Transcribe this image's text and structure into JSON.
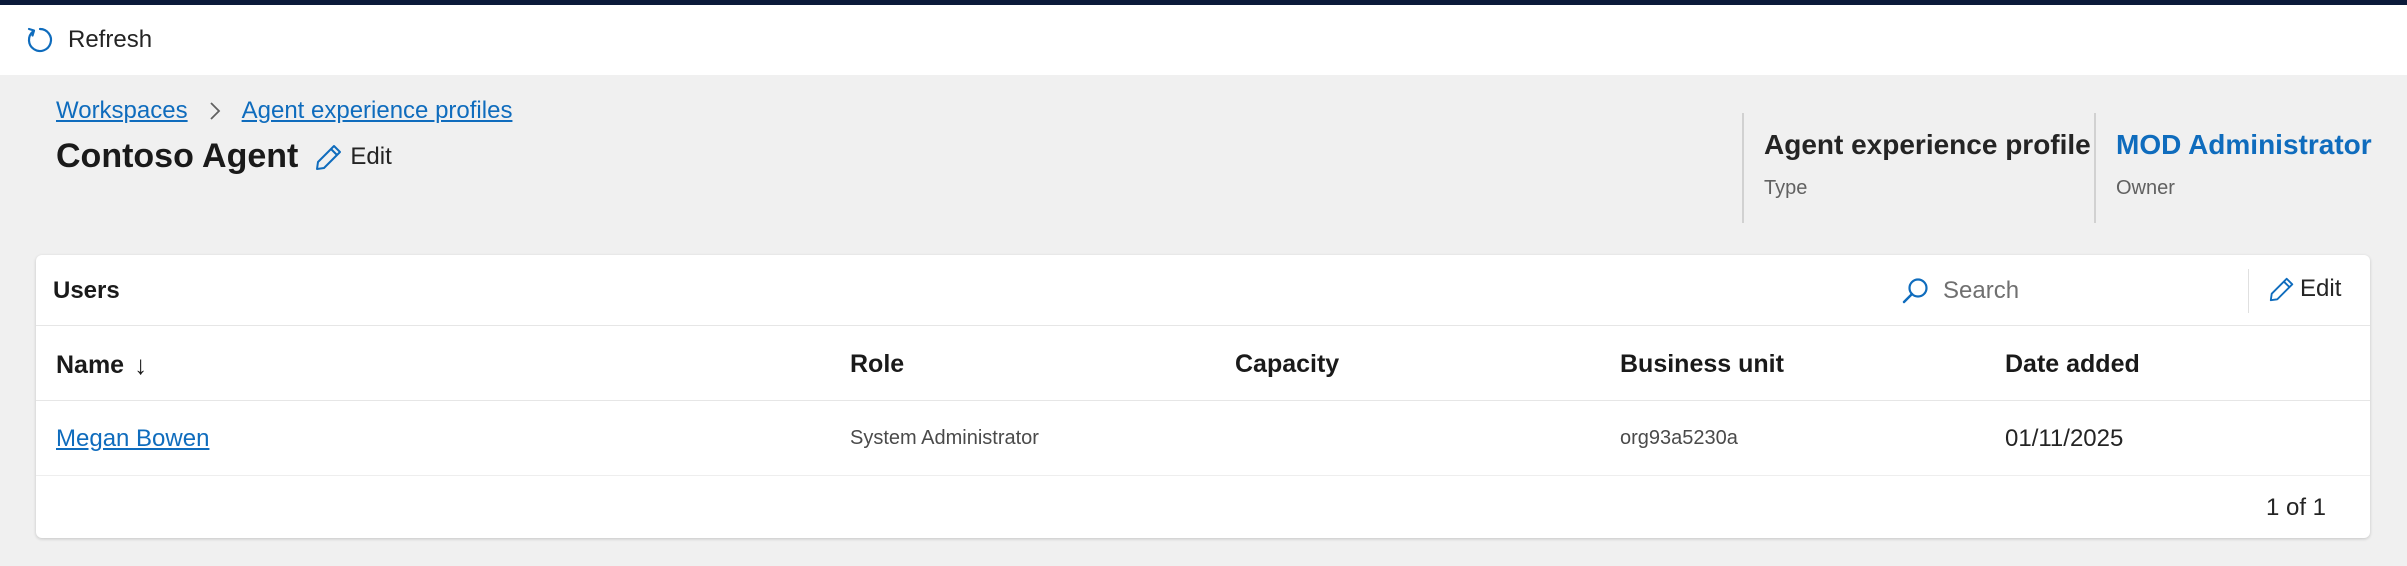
{
  "commandbar": {
    "refresh_label": "Refresh"
  },
  "breadcrumb": {
    "items": [
      "Workspaces",
      "Agent experience profiles"
    ]
  },
  "header": {
    "title": "Contoso Agent",
    "edit_label": "Edit",
    "meta": [
      {
        "value": "Agent experience profile",
        "label": "Type"
      },
      {
        "value": "MOD Administrator",
        "label": "Owner"
      }
    ]
  },
  "users_card": {
    "title": "Users",
    "search_placeholder": "Search",
    "edit_label": "Edit",
    "columns": [
      "Name",
      "Role",
      "Capacity",
      "Business unit",
      "Date added"
    ],
    "sort_indicator": "↓",
    "rows": [
      {
        "name": "Megan Bowen",
        "role": "System Administrator",
        "capacity": "",
        "business_unit": "org93a5230a",
        "date_added": "01/11/2025"
      }
    ],
    "pagination": "1 of 1"
  },
  "colors": {
    "accent": "#0f6cbd",
    "background": "#f0f0f0",
    "top_strip": "#0b1a3a"
  }
}
